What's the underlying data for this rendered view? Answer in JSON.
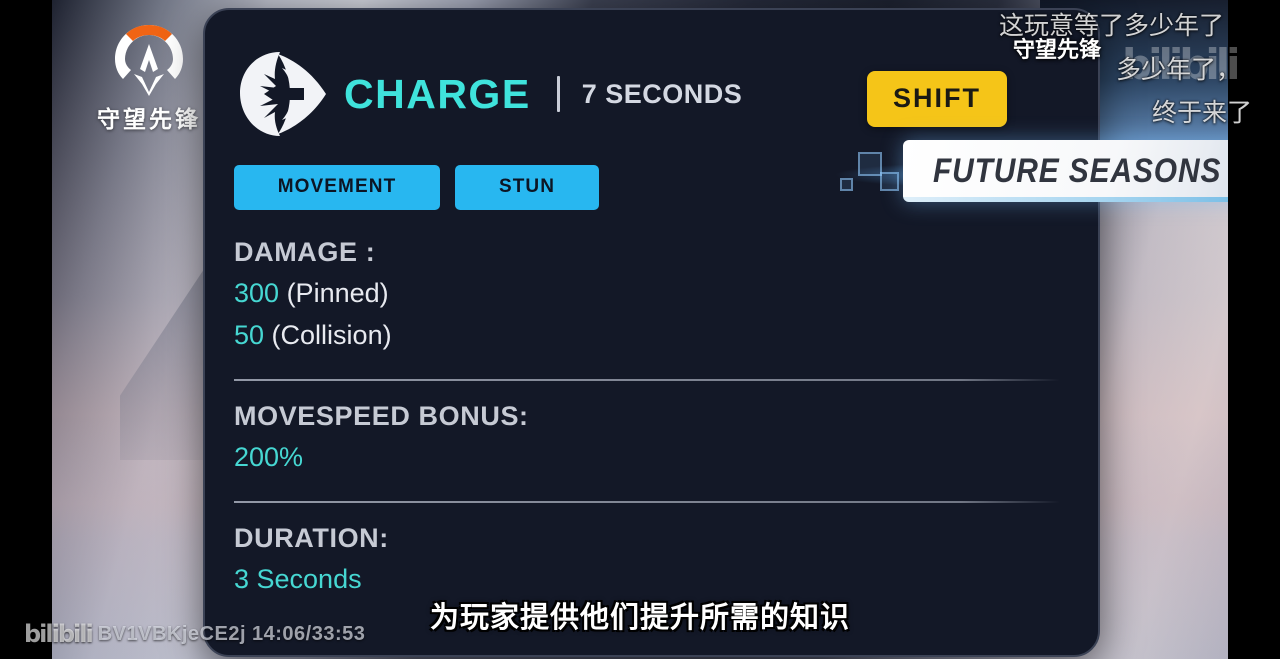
{
  "branding": {
    "logo_icon": "overwatch-logo-icon",
    "game_name_cn": "守望先锋",
    "logo_accent_color": "#f06414"
  },
  "ability": {
    "icon": "charge-ability-icon",
    "name": "CHARGE",
    "separator": "|",
    "cooldown": "7 SECONDS",
    "keybind": "SHIFT",
    "keybind_color": "#f5c518",
    "name_color": "#3fe3dc",
    "tags": [
      {
        "label": "MOVEMENT"
      },
      {
        "label": "STUN"
      }
    ],
    "tag_color": "#28b7f0",
    "stats": [
      {
        "label": "DAMAGE :",
        "lines": [
          {
            "value": "300",
            "note": " (Pinned)"
          },
          {
            "value": "50",
            "note": " (Collision)"
          }
        ]
      },
      {
        "label": "MOVESPEED BONUS:",
        "lines": [
          {
            "value": "200%",
            "note": ""
          }
        ]
      },
      {
        "label": "DURATION:",
        "lines": [
          {
            "value": "3 Seconds",
            "note": ""
          }
        ]
      }
    ],
    "value_color": "#46d7d2"
  },
  "banner": {
    "text": "FUTURE SEASONS"
  },
  "danmaku": [
    {
      "text": "这玩意等了多少年了"
    },
    {
      "text": "多少年了，"
    },
    {
      "text": "终于来了"
    }
  ],
  "danmaku_overlay": {
    "game_name": "守望先锋",
    "bilibili_watermark": "bilibili"
  },
  "subtitle": {
    "text": "为玩家提供他们提升所需的知识"
  },
  "player": {
    "site_logo": "bilibili",
    "video_id": "BV1VBKjeCE2j",
    "timestamp": "14:06/33:53"
  }
}
